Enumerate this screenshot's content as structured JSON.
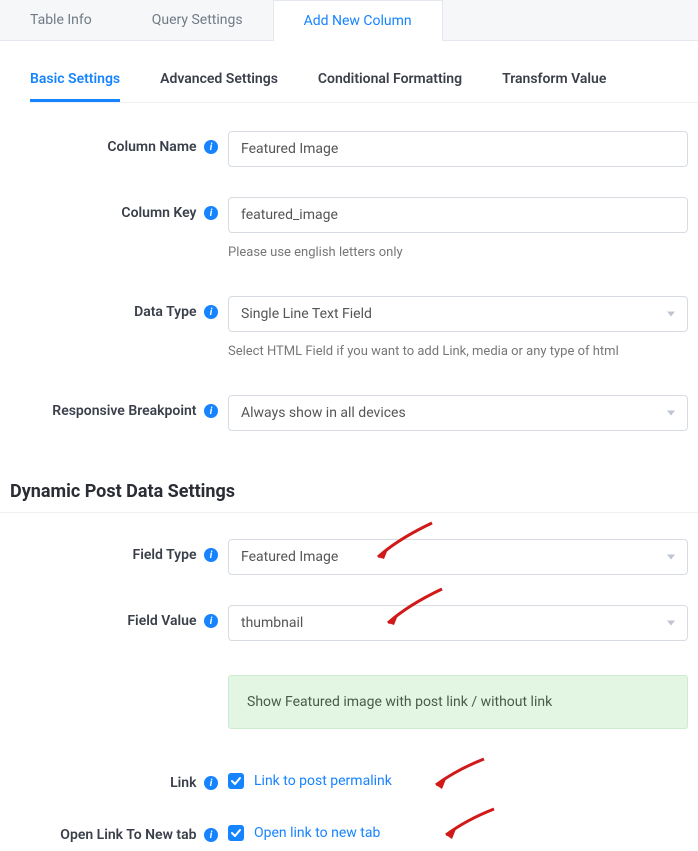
{
  "topTabs": {
    "tableInfo": "Table Info",
    "querySettings": "Query Settings",
    "addNewColumn": "Add New Column"
  },
  "subTabs": {
    "basic": "Basic Settings",
    "advanced": "Advanced Settings",
    "conditional": "Conditional Formatting",
    "transform": "Transform Value"
  },
  "form": {
    "columnName": {
      "label": "Column Name",
      "value": "Featured Image"
    },
    "columnKey": {
      "label": "Column Key",
      "value": "featured_image",
      "hint": "Please use english letters only"
    },
    "dataType": {
      "label": "Data Type",
      "value": "Single Line Text Field",
      "hint": "Select HTML Field if you want to add Link, media or any type of html"
    },
    "responsive": {
      "label": "Responsive Breakpoint",
      "value": "Always show in all devices"
    }
  },
  "dynamicSection": {
    "heading": "Dynamic Post Data Settings",
    "fieldType": {
      "label": "Field Type",
      "value": "Featured Image"
    },
    "fieldValue": {
      "label": "Field Value",
      "value": "thumbnail"
    },
    "banner": "Show Featured image with post link / without link",
    "link": {
      "label": "Link",
      "checkboxLabel": "Link to post permalink",
      "checked": true
    },
    "newTab": {
      "label": "Open Link To New tab",
      "checkboxLabel": "Open link to new tab",
      "checked": true
    }
  }
}
